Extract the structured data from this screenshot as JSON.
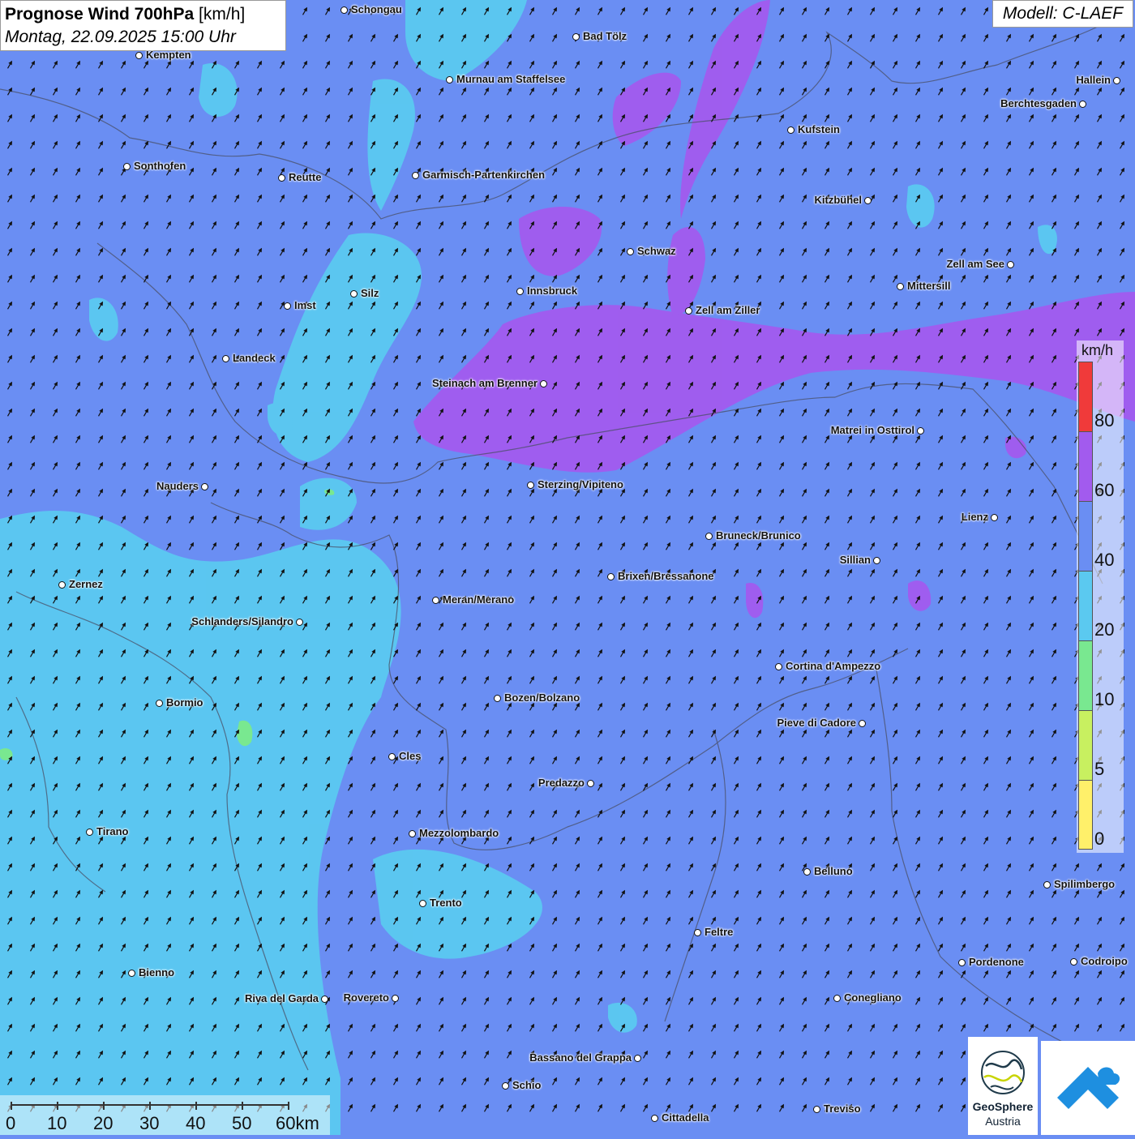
{
  "header": {
    "title_bold": "Prognose Wind 700hPa",
    "title_unit": "[km/h]",
    "datetime": "Montag, 22.09.2025 15:00 Uhr",
    "model": "Modell: C-LAEF"
  },
  "colors": {
    "background": "#6a8ef3",
    "wind_20_40": "#5bc9f0",
    "wind_40_60": "#6a8ef3",
    "wind_60_80": "#a25bee",
    "wind_80_plus": "#f03a3a",
    "wind_10_20": "#79e890",
    "wind_5_10": "#c8f060",
    "wind_0_5": "#fff06a"
  },
  "legend": {
    "unit": "km/h",
    "ticks": [
      "80",
      "60",
      "40",
      "20",
      "10",
      "5",
      "0"
    ],
    "segment_colors": [
      "#f03a3a",
      "#a25bee",
      "#6a8ef3",
      "#5bc9f0",
      "#79e890",
      "#c8f060",
      "#fff06a"
    ]
  },
  "wind_arrows": {
    "direction_icon": "arrow-north-northeast-icon"
  },
  "scale": {
    "ticks": [
      "0",
      "10",
      "20",
      "30",
      "40",
      "50",
      "60km"
    ]
  },
  "logos": {
    "geosphere_name": "GeoSphere",
    "geosphere_sub": "Austria",
    "brand_icon": "cloud-arrow-icon"
  },
  "cities": [
    {
      "name": "Schongau"
    },
    {
      "name": "Bad Tölz"
    },
    {
      "name": "Kempten"
    },
    {
      "name": "Murnau am Staffelsee"
    },
    {
      "name": "Hallein"
    },
    {
      "name": "Berchtesgaden"
    },
    {
      "name": "Kufstein"
    },
    {
      "name": "Sonthofen"
    },
    {
      "name": "Reutte"
    },
    {
      "name": "Garmisch-Partenkirchen"
    },
    {
      "name": "Kitzbühel"
    },
    {
      "name": "Schwaz"
    },
    {
      "name": "Zell am See"
    },
    {
      "name": "Mittersill"
    },
    {
      "name": "Silz"
    },
    {
      "name": "Innsbruck"
    },
    {
      "name": "Imst"
    },
    {
      "name": "Zell am Ziller"
    },
    {
      "name": "Landeck"
    },
    {
      "name": "Steinach am Brenner"
    },
    {
      "name": "Matrei in Osttirol"
    },
    {
      "name": "Nauders"
    },
    {
      "name": "Sterzing/Vipiteno"
    },
    {
      "name": "Lienz"
    },
    {
      "name": "Bruneck/Brunico"
    },
    {
      "name": "Sillian"
    },
    {
      "name": "Zernez"
    },
    {
      "name": "Brixen/Bressanone"
    },
    {
      "name": "Meran/Merano"
    },
    {
      "name": "Schlanders/Silandro"
    },
    {
      "name": "Cortina d'Ampezzo"
    },
    {
      "name": "Bozen/Bolzano"
    },
    {
      "name": "Bormio"
    },
    {
      "name": "Pieve di Cadore"
    },
    {
      "name": "Cles"
    },
    {
      "name": "Predazzo"
    },
    {
      "name": "Tirano"
    },
    {
      "name": "Mezzolombardo"
    },
    {
      "name": "Belluno"
    },
    {
      "name": "Spilimbergo"
    },
    {
      "name": "Trento"
    },
    {
      "name": "Feltre"
    },
    {
      "name": "Pordenone"
    },
    {
      "name": "Codroipo"
    },
    {
      "name": "Bienno"
    },
    {
      "name": "Riva del Garda"
    },
    {
      "name": "Rovereto"
    },
    {
      "name": "Conegliano"
    },
    {
      "name": "Bassano del Grappa"
    },
    {
      "name": "Schio"
    },
    {
      "name": "Treviso"
    },
    {
      "name": "Cittadella"
    }
  ]
}
